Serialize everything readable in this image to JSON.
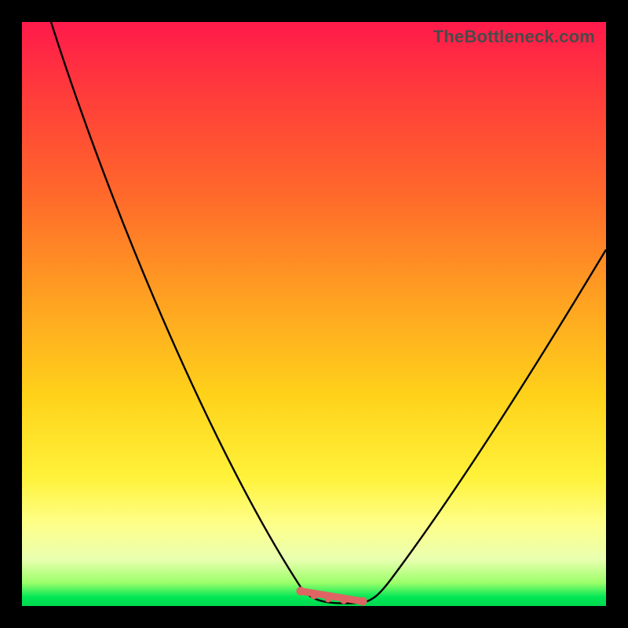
{
  "watermark": {
    "text": "TheBottleneck.com"
  },
  "colors": {
    "frame": "#000000",
    "curve": "#000000",
    "marker": "#de6563",
    "gradient_stops": [
      "#ff1a4b",
      "#ff3b3b",
      "#ff6a2a",
      "#ffa321",
      "#ffd21a",
      "#fff23a",
      "#feff8a",
      "#e9ffb0",
      "#9dff6a",
      "#00e756",
      "#00d94f"
    ]
  },
  "chart_data": {
    "type": "line",
    "title": "",
    "xlabel": "",
    "ylabel": "",
    "xlim": [
      0,
      100
    ],
    "ylim": [
      0,
      100
    ],
    "grid": false,
    "legend": false,
    "series": [
      {
        "name": "bottleneck-curve",
        "x": [
          5,
          10,
          15,
          20,
          25,
          30,
          35,
          40,
          45,
          48,
          50,
          52,
          55,
          58,
          60,
          65,
          70,
          75,
          80,
          85,
          90,
          95,
          100
        ],
        "values": [
          100,
          89,
          78,
          67,
          56,
          45,
          34,
          23,
          11,
          4,
          1,
          0,
          0,
          1,
          4,
          9,
          15,
          22,
          29,
          36,
          44,
          52,
          60
        ]
      }
    ],
    "annotations": [
      {
        "name": "optimal-flat-region",
        "shape": "rounded-segment",
        "x_range": [
          48,
          58
        ],
        "y": 0,
        "color": "#de6563"
      }
    ]
  }
}
